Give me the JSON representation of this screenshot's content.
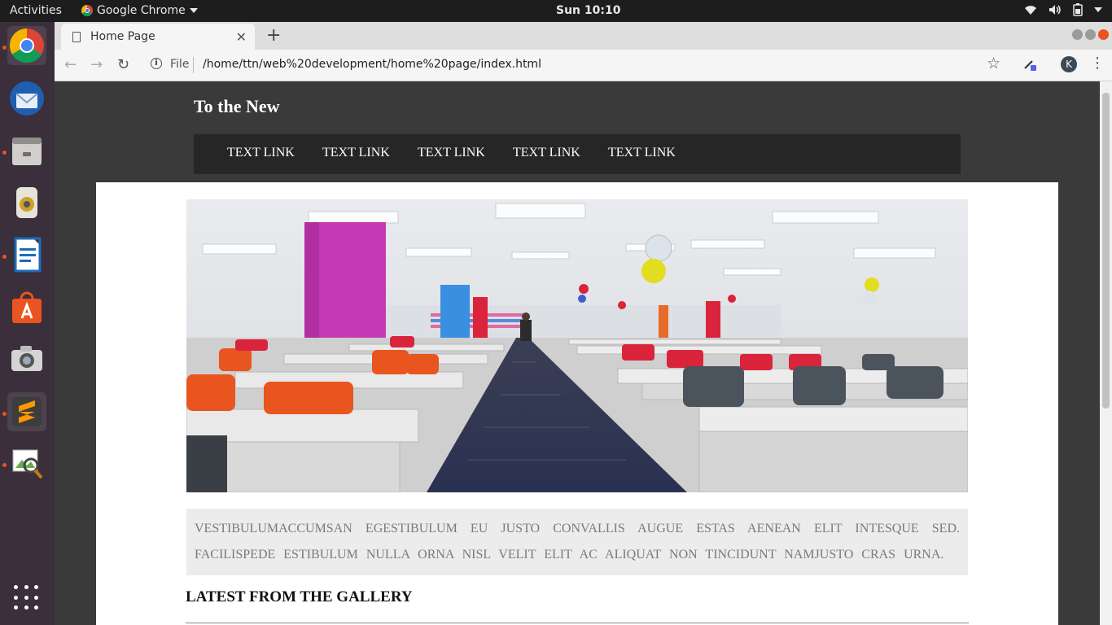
{
  "system_bar": {
    "activities": "Activities",
    "app_name": "Google Chrome",
    "clock": "Sun 10:10",
    "icons": [
      "wifi-icon",
      "volume-icon",
      "battery-icon",
      "power-menu-icon"
    ]
  },
  "dock": {
    "items": [
      {
        "name": "chrome",
        "icon": "chrome-icon",
        "running": true
      },
      {
        "name": "thunderbird",
        "icon": "thunderbird-icon",
        "running": false
      },
      {
        "name": "files",
        "icon": "files-icon",
        "running": true
      },
      {
        "name": "rhythmbox",
        "icon": "rhythmbox-icon",
        "running": false
      },
      {
        "name": "writer",
        "icon": "writer-icon",
        "running": true
      },
      {
        "name": "software",
        "icon": "software-icon",
        "running": false
      },
      {
        "name": "screenshot",
        "icon": "camera-icon",
        "running": false
      },
      {
        "name": "sublime",
        "icon": "sublime-icon",
        "running": true
      },
      {
        "name": "image-viewer",
        "icon": "image-viewer-icon",
        "running": true
      }
    ],
    "show_apps_icon": "apps-grid-icon"
  },
  "browser": {
    "tab_title": "Home Page",
    "url_scheme_label": "File",
    "url": "/home/ttn/web%20development/home%20page/index.html",
    "profile_initial": "K"
  },
  "site": {
    "title": "To the New",
    "nav_links": [
      "TEXT LINK",
      "TEXT LINK",
      "TEXT LINK",
      "TEXT LINK",
      "TEXT LINK"
    ],
    "intro_text": "Vestibulumaccumsan egestibulum eu justo convallis augue estas aenean elit intesque sed. Facilispede estibulum nulla orna nisl velit elit ac aliquat non tincidunt namjusto cras urna.",
    "gallery_heading": "LATEST FROM THE GALLERY"
  },
  "colors": {
    "header_bg": "#3a3a3a",
    "nav_bg": "#262626",
    "intro_bg": "#ececec",
    "accent": "#e95420"
  }
}
